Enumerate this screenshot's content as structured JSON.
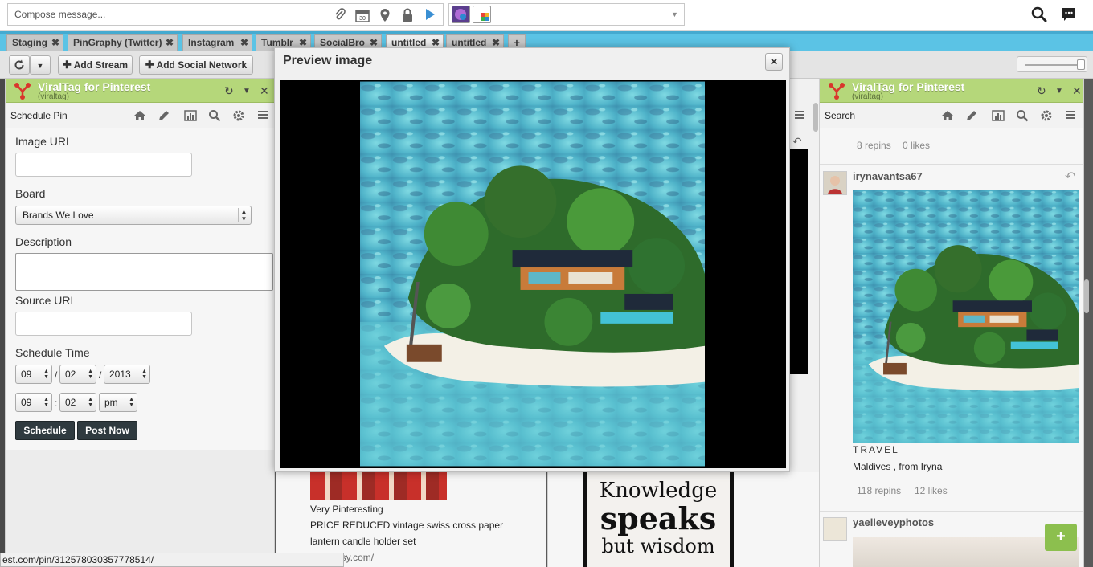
{
  "compose": {
    "placeholder": "Compose message...",
    "calendar_day": "30"
  },
  "tabs": [
    {
      "label": "Staging"
    },
    {
      "label": "PinGraphy (Twitter)"
    },
    {
      "label": "Instagram"
    },
    {
      "label": "Tumblr"
    },
    {
      "label": "SocialBro"
    },
    {
      "label": "untitled"
    },
    {
      "label": "untitled"
    }
  ],
  "tab_add": "+",
  "toolbar": {
    "add_stream": "Add Stream",
    "add_network": "Add Social Network"
  },
  "left_column": {
    "title": "ViralTag for Pinterest",
    "subtitle": "(viraltag)",
    "section": "Schedule Pin",
    "image_url_label": "Image URL",
    "board_label": "Board",
    "board_value": "Brands We Love",
    "description_label": "Description",
    "source_url_label": "Source URL",
    "schedule_time_label": "Schedule Time",
    "date": {
      "month": "09",
      "day": "02",
      "year": "2013",
      "sep": "/"
    },
    "time": {
      "hour": "09",
      "minute": "02",
      "ampm": "pm",
      "sep": ":"
    },
    "schedule_button": "Schedule",
    "post_now_button": "Post Now"
  },
  "middle_content": {
    "line1": "Very Pinteresting",
    "line2": "PRICE REDUCED vintage swiss cross paper",
    "line3": "lantern candle holder set",
    "line4": "www.etsy.com/"
  },
  "knowledge_image": {
    "line1": "Knowledge",
    "line2": "speaks",
    "line3": "but wisdom"
  },
  "right_column": {
    "title": "ViralTag for Pinterest",
    "subtitle": "(viraltag)",
    "section": "Search",
    "first_repins": "8 repins",
    "first_likes": "0 likes",
    "pin_user": "irynavantsa67",
    "pin_board": "TRAVEL",
    "pin_caption": "Maldives , from Iryna",
    "pin_repins": "118 repins",
    "pin_likes": "12 likes",
    "next_user": "yaelleveyphotos"
  },
  "modal": {
    "title": "Preview image",
    "close": "✕"
  },
  "status_url": "est.com/pin/312578030357778514/",
  "fab": "+",
  "colors": {
    "accent_green": "#b5d77a",
    "tab_blue": "#5bc3e5",
    "dark_button": "#2f3a3f"
  }
}
